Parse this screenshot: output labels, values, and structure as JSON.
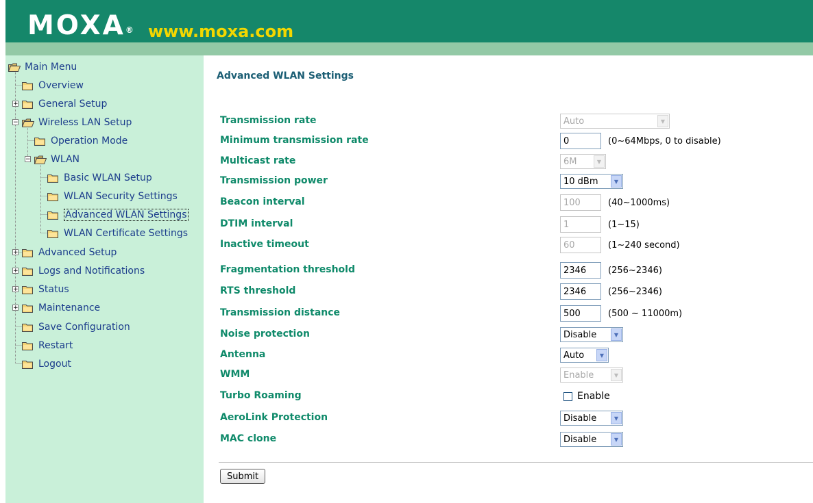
{
  "header": {
    "logo_text": "MOXA",
    "logo_reg": "®",
    "site_url": "www.moxa.com",
    "colors": {
      "band": "#15876a",
      "stripe": "#93c9a6",
      "url": "#f3d700"
    }
  },
  "sidebar": {
    "root": "Main Menu",
    "items": [
      {
        "label": "Overview"
      },
      {
        "label": "General Setup",
        "toggle": "+"
      },
      {
        "label": "Wireless LAN Setup",
        "toggle": "−"
      },
      {
        "label": "Operation Mode"
      },
      {
        "label": "WLAN",
        "toggle": "−"
      },
      {
        "label": "Basic WLAN Setup"
      },
      {
        "label": "WLAN Security Settings"
      },
      {
        "label": "Advanced WLAN Settings",
        "selected": true
      },
      {
        "label": "WLAN Certificate Settings"
      },
      {
        "label": "Advanced Setup",
        "toggle": "+"
      },
      {
        "label": "Logs and Notifications",
        "toggle": "+"
      },
      {
        "label": "Status",
        "toggle": "+"
      },
      {
        "label": "Maintenance",
        "toggle": "+"
      },
      {
        "label": "Save Configuration"
      },
      {
        "label": "Restart"
      },
      {
        "label": "Logout"
      }
    ]
  },
  "main": {
    "title": "Advanced WLAN Settings",
    "rows": [
      {
        "label": "Transmission rate",
        "type": "select",
        "value": "Auto",
        "disabled": true
      },
      {
        "label": "Minimum transmission rate",
        "type": "text",
        "value": "0",
        "hint": "(0~64Mbps, 0 to disable)"
      },
      {
        "label": "Multicast rate",
        "type": "select",
        "value": "6M",
        "disabled": true
      },
      {
        "label": "Transmission power",
        "type": "select",
        "value": "10 dBm"
      },
      {
        "label": "Beacon interval",
        "type": "text",
        "value": "100",
        "disabled": true,
        "hint": "(40~1000ms)"
      },
      {
        "label": "DTIM interval",
        "type": "text",
        "value": "1",
        "disabled": true,
        "hint": "(1~15)"
      },
      {
        "label": "Inactive timeout",
        "type": "text",
        "value": "60",
        "disabled": true,
        "hint": "(1~240 second)"
      },
      {
        "label": "Fragmentation threshold",
        "type": "text",
        "value": "2346",
        "hint": "(256~2346)"
      },
      {
        "label": "RTS threshold",
        "type": "text",
        "value": "2346",
        "hint": "(256~2346)"
      },
      {
        "label": "Transmission distance",
        "type": "text",
        "value": "500",
        "hint": "(500 ~ 11000m)"
      },
      {
        "label": "Noise protection",
        "type": "select",
        "value": "Disable"
      },
      {
        "label": "Antenna",
        "type": "select",
        "value": "Auto"
      },
      {
        "label": "WMM",
        "type": "select",
        "value": "Enable",
        "disabled": true
      },
      {
        "label": "Turbo Roaming",
        "type": "checkbox",
        "checked": false,
        "option": "Enable"
      },
      {
        "label": "AeroLink Protection",
        "type": "select",
        "value": "Disable"
      },
      {
        "label": "MAC clone",
        "type": "select",
        "value": "Disable"
      }
    ],
    "submit_label": "Submit"
  }
}
